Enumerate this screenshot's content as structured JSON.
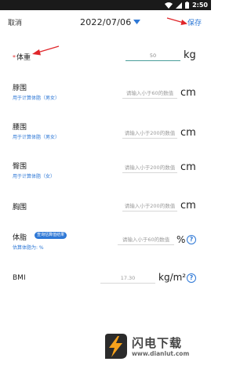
{
  "status_bar": {
    "time": "2:50"
  },
  "toolbar": {
    "cancel_label": "取消",
    "date": "2022/07/06",
    "save_label": "保存"
  },
  "fields": {
    "weight": {
      "required_mark": "*",
      "label": "体重",
      "value": "50",
      "unit": "kg"
    },
    "neck": {
      "label": "脖围",
      "sub": "用于计算体脂（男女）",
      "placeholder": "请输入小于60的数值",
      "unit": "cm"
    },
    "waist": {
      "label": "腰围",
      "sub": "用于计算体脂（男女）",
      "placeholder": "请输入小于200的数值",
      "unit": "cm"
    },
    "hip": {
      "label": "臀围",
      "sub": "用于计算体脂（女）",
      "placeholder": "请输入小于200的数值",
      "unit": "cm"
    },
    "chest": {
      "label": "胸围",
      "placeholder": "请输入小于200的数值",
      "unit": "cm"
    },
    "body_fat": {
      "label": "体脂",
      "badge": "查询估算值结果",
      "sub": "估算体脂为: %",
      "placeholder": "请输入小于60的数值",
      "unit": "%"
    },
    "bmi": {
      "label": "BMI",
      "value": "17.30",
      "unit": "kg/m²"
    }
  },
  "watermark": {
    "title": "闪电下载",
    "url": "www.dianlut.com"
  },
  "colors": {
    "accent": "#2e78d6",
    "required": "#e03030",
    "active_line": "#4a9e9a",
    "arrow": "#e0262a"
  }
}
